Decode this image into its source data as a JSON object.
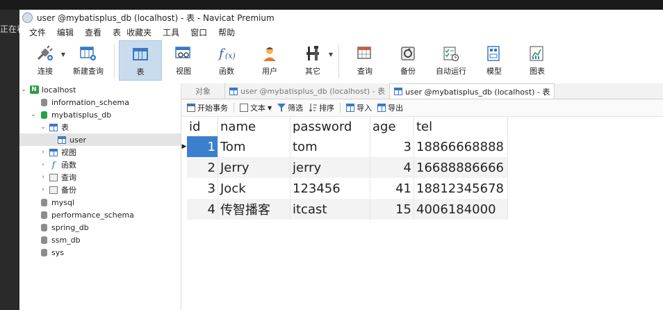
{
  "behind_text": "正在看",
  "window": {
    "title": "user @mybatisplus_db (localhost) - 表 - Navicat Premium"
  },
  "menu": [
    "文件",
    "编辑",
    "查看",
    "表",
    "收藏夹",
    "工具",
    "窗口",
    "帮助"
  ],
  "toolbar": [
    {
      "label": "连接",
      "icon": "plug-icon"
    },
    {
      "label": "新建查询",
      "icon": "new-query-icon"
    },
    {
      "label": "表",
      "icon": "table-icon"
    },
    {
      "label": "视图",
      "icon": "view-icon"
    },
    {
      "label": "函数",
      "icon": "function-icon"
    },
    {
      "label": "用户",
      "icon": "user-icon"
    },
    {
      "label": "其它",
      "icon": "tools-icon"
    },
    {
      "label": "查询",
      "icon": "query-icon"
    },
    {
      "label": "备份",
      "icon": "backup-icon"
    },
    {
      "label": "自动运行",
      "icon": "automation-icon"
    },
    {
      "label": "模型",
      "icon": "model-icon"
    },
    {
      "label": "图表",
      "icon": "chart-icon"
    }
  ],
  "navigator": {
    "connection": "localhost",
    "databases": [
      "information_schema",
      "mybatisplus_db",
      "mysql",
      "performance_schema",
      "spring_db",
      "ssm_db",
      "sys"
    ],
    "groups": {
      "tables": "表",
      "views": "视图",
      "functions": "函数",
      "queries": "查询",
      "backups": "备份"
    },
    "selected_table": "user"
  },
  "tabs": {
    "objects": "对象",
    "tab1": "user @mybatisplus_db (localhost) - 表",
    "tab2": "user @mybatisplus_db (localhost) - 表"
  },
  "subtoolbar": {
    "begin_transaction": "开始事务",
    "text": "文本",
    "filter": "筛选",
    "sort": "排序",
    "import": "导入",
    "export": "导出"
  },
  "grid": {
    "columns": [
      "id",
      "name",
      "password",
      "age",
      "tel"
    ],
    "rows": [
      [
        "1",
        "Tom",
        "tom",
        "3",
        "18866668888"
      ],
      [
        "2",
        "Jerry",
        "jerry",
        "4",
        "16688886666"
      ],
      [
        "3",
        "Jock",
        "123456",
        "41",
        "18812345678"
      ],
      [
        "4",
        "传智播客",
        "itcast",
        "15",
        "4006184000"
      ]
    ]
  },
  "colors": {
    "accent": "#3b80cf",
    "db_active": "#27a046",
    "toolbar_active": "#c9dcee"
  }
}
